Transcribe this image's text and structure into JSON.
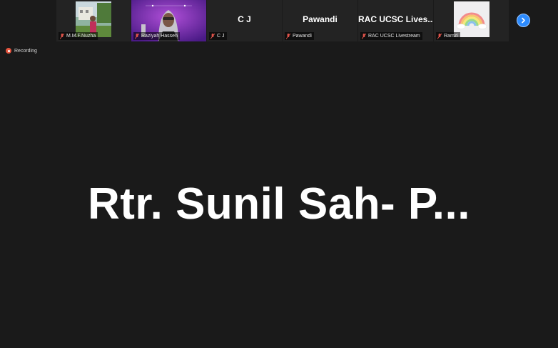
{
  "participants": [
    {
      "display": "",
      "label": "M.M.F.Nuzha"
    },
    {
      "display": "",
      "label": "Raziyah Hassen"
    },
    {
      "display": "C J",
      "label": "C J"
    },
    {
      "display": "Pawandi",
      "label": "Pawandi"
    },
    {
      "display": "RAC UCSC Lives...",
      "label": "RAC UCSC Livestream"
    },
    {
      "display": "",
      "label": "Ramzi"
    }
  ],
  "recording_label": "Recording",
  "active_speaker": "Rtr. Sunil Sah- P...",
  "colors": {
    "background": "#1a1a1a",
    "tile": "#232323",
    "muted_mic": "#e0534a",
    "next_button": "#2d8cff",
    "recording": "#e8563f"
  }
}
